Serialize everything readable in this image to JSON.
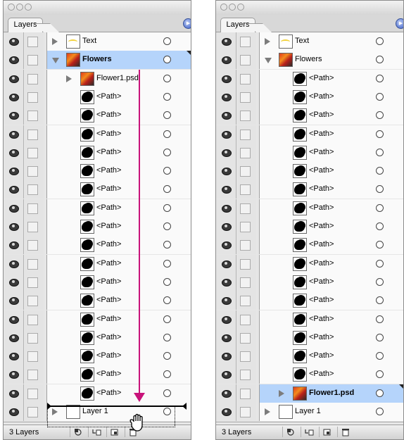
{
  "tab_label": "Layers",
  "left_panel": {
    "rows": [
      {
        "label": "Text",
        "kind": "text",
        "indent": 0,
        "arrow": "right",
        "bold": false
      },
      {
        "label": "Flowers",
        "kind": "flower",
        "indent": 0,
        "arrow": "down",
        "bold": true,
        "selected": true
      },
      {
        "label": "Flower1.psd",
        "kind": "flower",
        "indent": 1,
        "arrow": "right",
        "bold": false
      },
      {
        "label": "<Path>",
        "kind": "path",
        "indent": 2
      },
      {
        "label": "<Path>",
        "kind": "path",
        "indent": 2
      },
      {
        "label": "<Path>",
        "kind": "path",
        "indent": 2
      },
      {
        "label": "<Path>",
        "kind": "path",
        "indent": 2
      },
      {
        "label": "<Path>",
        "kind": "path",
        "indent": 2
      },
      {
        "label": "<Path>",
        "kind": "path",
        "indent": 2
      },
      {
        "label": "<Path>",
        "kind": "path",
        "indent": 2
      },
      {
        "label": "<Path>",
        "kind": "path",
        "indent": 2
      },
      {
        "label": "<Path>",
        "kind": "path",
        "indent": 2
      },
      {
        "label": "<Path>",
        "kind": "path",
        "indent": 2
      },
      {
        "label": "<Path>",
        "kind": "path",
        "indent": 2
      },
      {
        "label": "<Path>",
        "kind": "path",
        "indent": 2
      },
      {
        "label": "<Path>",
        "kind": "path",
        "indent": 2
      },
      {
        "label": "<Path>",
        "kind": "path",
        "indent": 2
      },
      {
        "label": "<Path>",
        "kind": "path",
        "indent": 2
      },
      {
        "label": "<Path>",
        "kind": "path",
        "indent": 2
      },
      {
        "label": "<Path>",
        "kind": "path",
        "indent": 2
      },
      {
        "label": "Layer 1",
        "kind": "empty",
        "indent": 0,
        "arrow": "right",
        "bold": false
      }
    ],
    "layer_count": "3 Layers"
  },
  "right_panel": {
    "rows": [
      {
        "label": "Text",
        "kind": "text",
        "indent": 0,
        "arrow": "right",
        "bold": false
      },
      {
        "label": "Flowers",
        "kind": "flower",
        "indent": 0,
        "arrow": "down",
        "bold": false
      },
      {
        "label": "<Path>",
        "kind": "path",
        "indent": 2
      },
      {
        "label": "<Path>",
        "kind": "path",
        "indent": 2
      },
      {
        "label": "<Path>",
        "kind": "path",
        "indent": 2
      },
      {
        "label": "<Path>",
        "kind": "path",
        "indent": 2
      },
      {
        "label": "<Path>",
        "kind": "path",
        "indent": 2
      },
      {
        "label": "<Path>",
        "kind": "path",
        "indent": 2
      },
      {
        "label": "<Path>",
        "kind": "path",
        "indent": 2
      },
      {
        "label": "<Path>",
        "kind": "path",
        "indent": 2
      },
      {
        "label": "<Path>",
        "kind": "path",
        "indent": 2
      },
      {
        "label": "<Path>",
        "kind": "path",
        "indent": 2
      },
      {
        "label": "<Path>",
        "kind": "path",
        "indent": 2
      },
      {
        "label": "<Path>",
        "kind": "path",
        "indent": 2
      },
      {
        "label": "<Path>",
        "kind": "path",
        "indent": 2
      },
      {
        "label": "<Path>",
        "kind": "path",
        "indent": 2
      },
      {
        "label": "<Path>",
        "kind": "path",
        "indent": 2
      },
      {
        "label": "<Path>",
        "kind": "path",
        "indent": 2
      },
      {
        "label": "<Path>",
        "kind": "path",
        "indent": 2
      },
      {
        "label": "Flower1.psd",
        "kind": "flower",
        "indent": 1,
        "arrow": "right",
        "bold": true,
        "selected": true
      },
      {
        "label": "Layer 1",
        "kind": "empty",
        "indent": 0,
        "arrow": "right",
        "bold": false
      }
    ],
    "layer_count": "3 Layers"
  },
  "colors": {
    "selection": "#b5d4fb",
    "drag_arrow": "#c8137a"
  },
  "icons": [
    "eye-icon",
    "lock-toggle",
    "layer-thumbnail",
    "target-circle-icon",
    "panel-menu-icon",
    "clipping-mask-icon",
    "sublayer-icon",
    "new-layer-icon",
    "trash-icon"
  ]
}
